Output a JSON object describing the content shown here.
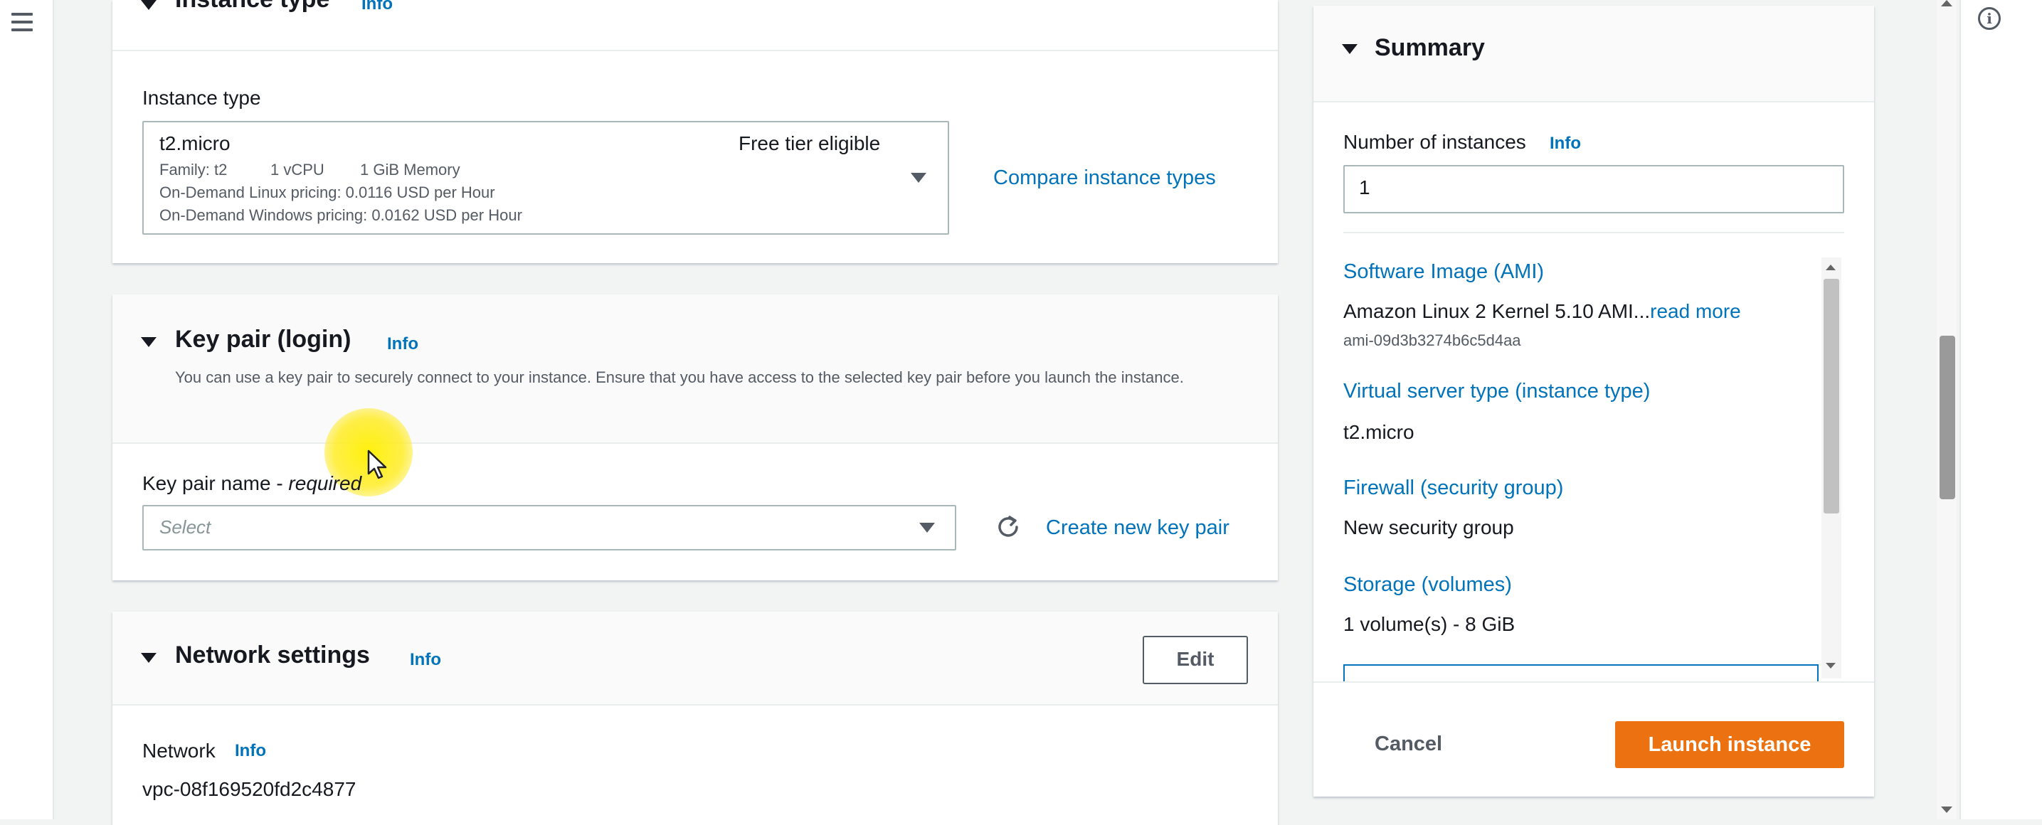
{
  "instance_type": {
    "section_title": "Instance type",
    "info": "Info",
    "field_label": "Instance type",
    "selected_value": "t2.micro",
    "free_tier": "Free tier eligible",
    "family": "Family: t2",
    "vcpu": "1 vCPU",
    "memory": "1 GiB Memory",
    "linux_pricing": "On-Demand Linux pricing: 0.0116 USD per Hour",
    "windows_pricing": "On-Demand Windows pricing: 0.0162 USD per Hour",
    "compare_link": "Compare instance types"
  },
  "key_pair": {
    "section_title": "Key pair (login)",
    "info": "Info",
    "description": "You can use a key pair to securely connect to your instance. Ensure that you have access to the selected key pair before you launch the instance.",
    "field_label": "Key pair name - ",
    "required": "required",
    "placeholder": "Select",
    "create_link": "Create new key pair"
  },
  "network_settings": {
    "section_title": "Network settings",
    "info": "Info",
    "edit_button": "Edit",
    "network_label": "Network",
    "network_info": "Info",
    "network_value": "vpc-08f169520fd2c4877"
  },
  "summary": {
    "title": "Summary",
    "instances_label": "Number of instances",
    "instances_info": "Info",
    "instances_value": "1",
    "ami_heading": "Software Image (AMI)",
    "ami_value": "Amazon Linux 2 Kernel 5.10 AMI...",
    "ami_read_more": "read more",
    "ami_id": "ami-09d3b3274b6c5d4aa",
    "server_type_heading": "Virtual server type (instance type)",
    "server_type_value": "t2.micro",
    "firewall_heading": "Firewall (security group)",
    "firewall_value": "New security group",
    "storage_heading": "Storage (volumes)",
    "storage_value": "1 volume(s) - 8 GiB",
    "cancel_button": "Cancel",
    "launch_button": "Launch instance"
  },
  "colors": {
    "link": "#0073bb",
    "primary_button": "#ec7211",
    "text": "#16191f",
    "muted_text": "#545b64",
    "background": "#f2f3f3"
  },
  "icons": [
    "menu-icon",
    "info-circle-icon",
    "caret-down-icon",
    "dropdown-arrow-icon",
    "refresh-icon",
    "mouse-cursor-icon"
  ]
}
